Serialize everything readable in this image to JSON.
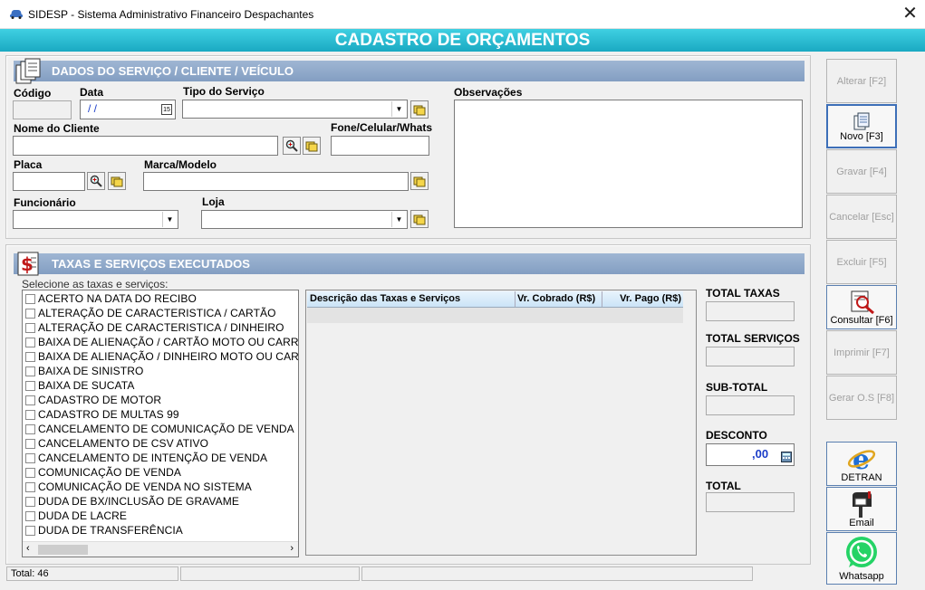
{
  "window": {
    "title": "SIDESP - Sistema Administrativo Financeiro Despachantes",
    "close_glyph": "✕"
  },
  "banner": {
    "title": "CADASTRO DE ORÇAMENTOS"
  },
  "section_customer": {
    "title": "DADOS DO SERVIÇO / CLIENTE / VEÍCULO",
    "codigo_label": "Código",
    "data_label": "Data",
    "data_value": " / /",
    "tipo_servico_label": "Tipo do Serviço",
    "observacoes_label": "Observações",
    "nome_cliente_label": "Nome do Cliente",
    "fone_label": "Fone/Celular/Whats",
    "placa_label": "Placa",
    "marca_modelo_label": "Marca/Modelo",
    "funcionario_label": "Funcionário",
    "loja_label": "Loja",
    "calendar_glyph": "15"
  },
  "section_taxes": {
    "title": "TAXAS E SERVIÇOS EXECUTADOS",
    "select_label": "Selecione as taxas e serviços:",
    "items": [
      "ACERTO NA DATA DO RECIBO",
      "ALTERAÇÃO DE CARACTERISTICA / CARTÃO",
      "ALTERAÇÃO DE CARACTERISTICA / DINHEIRO",
      "BAIXA DE ALIENAÇÃO /  CARTÃO MOTO OU CARR",
      "BAIXA DE ALIENAÇÃO / DINHEIRO MOTO OU CAR",
      "BAIXA DE SINISTRO",
      "BAIXA DE SUCATA",
      "CADASTRO DE MOTOR",
      "CADASTRO DE MULTAS 99",
      "CANCELAMENTO DE COMUNICAÇÃO DE VENDA",
      "CANCELAMENTO DE CSV ATIVO",
      "CANCELAMENTO DE INTENÇÃO DE VENDA",
      "COMUNICAÇÃO DE VENDA",
      "COMUNICAÇÃO DE VENDA NO SISTEMA",
      "DUDA DE BX/INCLUSÃO DE GRAVAME",
      "DUDA DE LACRE",
      "DUDA DE TRANSFERÊNCIA"
    ],
    "grid_headers": [
      "Descrição das Taxas e Serviços",
      "Vr. Cobrado (R$)",
      "Vr. Pago (R$)"
    ],
    "total_taxas_label": "TOTAL TAXAS",
    "total_servicos_label": "TOTAL SERVIÇOS",
    "subtotal_label": "SUB-TOTAL",
    "desconto_label": "DESCONTO",
    "desconto_value": ",00",
    "total_label": "TOTAL"
  },
  "side_buttons": {
    "alterar": "Alterar [F2]",
    "novo": "Novo [F3]",
    "gravar": "Gravar [F4]",
    "cancelar": "Cancelar [Esc]",
    "excluir": "Excluir [F5]",
    "consultar": "Consultar [F6]",
    "imprimir": "Imprimir [F7]",
    "gerar_os": "Gerar O.S [F8]",
    "detran": "DETRAN",
    "email": "Email",
    "whatsapp": "Whatsapp"
  },
  "status": {
    "total": "Total: 46"
  },
  "colors": {
    "banner": "#1aa9c2",
    "section_bar": "#8fa8c8",
    "whatsapp": "#25d366"
  }
}
